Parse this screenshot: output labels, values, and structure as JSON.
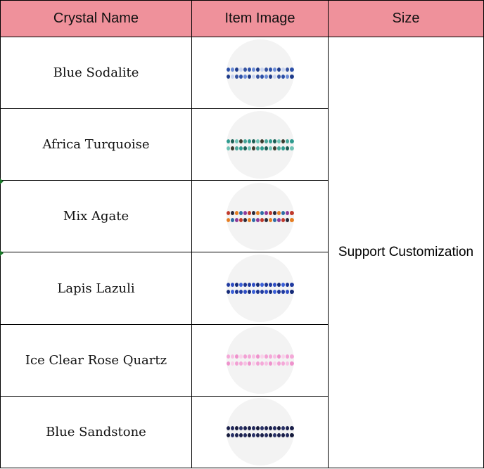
{
  "table": {
    "headers": {
      "name": "Crystal Name",
      "image": "Item Image",
      "size": "Size"
    },
    "size_value": "Support Customization",
    "header_color": "#ef919b",
    "rows": [
      {
        "name": "Blue Sodalite",
        "image_icon": "blue-sodalite-bead-strand",
        "colors": [
          "#2b4fa8",
          "#6b8bd6",
          "#1d3a8a",
          "#c8d3ef",
          "#3552a0"
        ]
      },
      {
        "name": "Africa Turquoise",
        "image_icon": "africa-turquoise-bead-strand",
        "colors": [
          "#2f9a8e",
          "#1b5e54",
          "#6fc2b5",
          "#3b3b2e",
          "#48a599"
        ]
      },
      {
        "name": "Mix Agate",
        "image_icon": "mix-agate-bead-strand",
        "colors": [
          "#c0392b",
          "#2a2a3a",
          "#e67e22",
          "#2e6da4",
          "#8e3b9a"
        ]
      },
      {
        "name": "Lapis Lazuli",
        "image_icon": "lapis-lazuli-bead-strand",
        "colors": [
          "#1f3aa0",
          "#2e4dc4",
          "#142a78",
          "#3a5fd8",
          "#1a3290"
        ]
      },
      {
        "name": "Ice Clear Rose Quartz",
        "image_icon": "rose-quartz-bead-strand",
        "colors": [
          "#f4a8d8",
          "#f7c0e3",
          "#ee92cc",
          "#f9d2ea",
          "#f2a0d4"
        ]
      },
      {
        "name": "Blue Sandstone",
        "image_icon": "blue-sandstone-bead-strand",
        "colors": [
          "#1a1f4a",
          "#232a5e",
          "#151a3c",
          "#2a3268",
          "#1c2250"
        ]
      }
    ]
  }
}
